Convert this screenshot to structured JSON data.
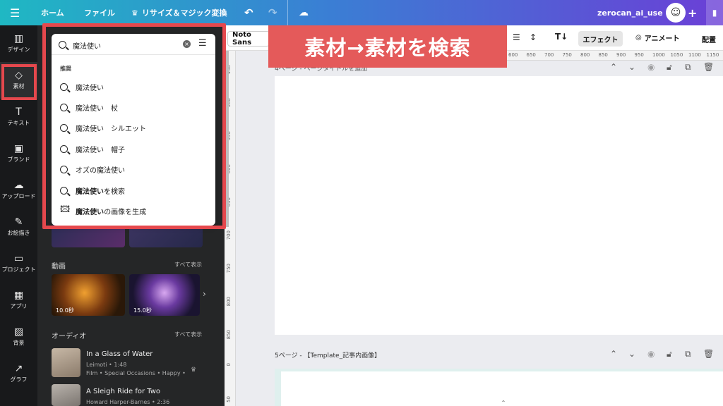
{
  "topbar": {
    "menu_icon": "hamburger-icon",
    "home": "ホーム",
    "file": "ファイル",
    "resize": "リサイズ＆マジック変換",
    "account": "zerocan_ai_use"
  },
  "rail": {
    "items": [
      {
        "label": "デザイン",
        "icon": "layout-icon"
      },
      {
        "label": "素材",
        "icon": "elements-icon"
      },
      {
        "label": "テキスト",
        "icon": "text-icon"
      },
      {
        "label": "ブランド",
        "icon": "brand-icon"
      },
      {
        "label": "アップロード",
        "icon": "upload-icon"
      },
      {
        "label": "お絵描き",
        "icon": "draw-icon"
      },
      {
        "label": "プロジェクト",
        "icon": "folder-icon"
      },
      {
        "label": "アプリ",
        "icon": "apps-icon"
      },
      {
        "label": "背景",
        "icon": "background-icon"
      },
      {
        "label": "グラフ",
        "icon": "chart-icon"
      }
    ]
  },
  "search": {
    "value": "魔法使い",
    "suggest_header": "推奨",
    "suggestions": [
      "魔法使い",
      "魔法使い　杖",
      "魔法使い　シルエット",
      "魔法使い　帽子",
      "オズの魔法使い"
    ],
    "search_bold": "魔法使い",
    "search_rest": "を検索",
    "generate_bold": "魔法使い",
    "generate_rest": "の画像を生成"
  },
  "panel": {
    "videos_title": "動画",
    "see_all": "すべて表示",
    "video1_duration": "10.0秒",
    "video2_duration": "15.0秒",
    "audio_title": "オーディオ",
    "audio": [
      {
        "title": "In a Glass of Water",
        "artist": "Leimoti • 1:48",
        "tags": "Film • Special Occasions • Happy •"
      },
      {
        "title": "A Sleigh Ride for Two",
        "artist": "Howard Harper-Barnes • 2:36",
        "tags": ""
      }
    ]
  },
  "toolbar": {
    "font": "Noto Sans",
    "effects": "エフェクト",
    "animate": "アニメート",
    "position": "配置"
  },
  "banner": "素材→素材を検索",
  "rulers": {
    "h": [
      "600",
      "650",
      "700",
      "750",
      "800",
      "850",
      "900",
      "950",
      "1000",
      "1050",
      "1100",
      "1150"
    ],
    "v": [
      "450",
      "500",
      "550",
      "600",
      "650",
      "700",
      "750",
      "800",
      "850",
      "0",
      "50"
    ]
  },
  "pages": {
    "page4_title": "4ページ - ページタイトルを追加",
    "page5_title": "5ページ - 【Template_記事内画像】"
  }
}
